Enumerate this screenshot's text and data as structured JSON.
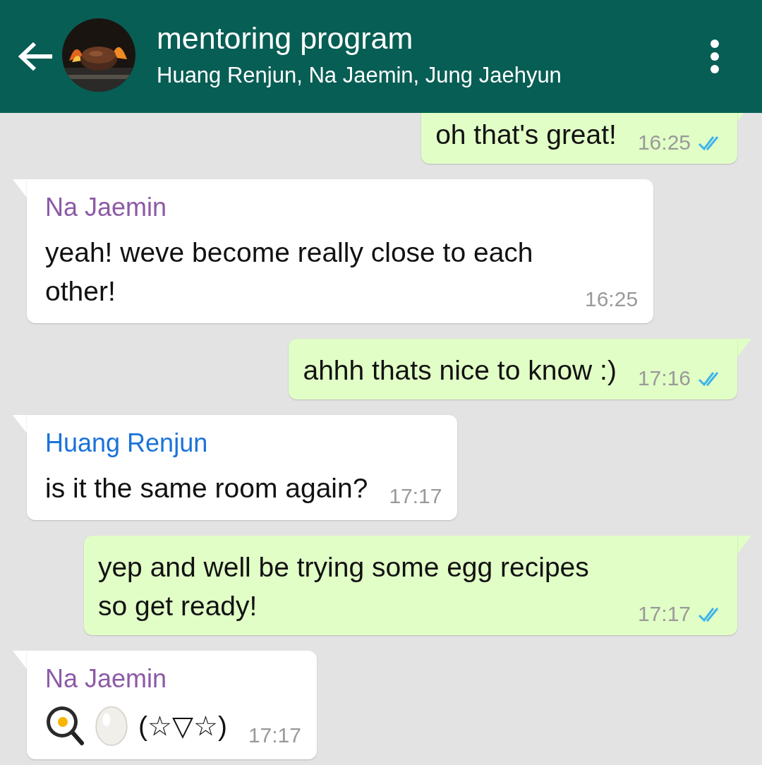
{
  "header": {
    "title": "mentoring program",
    "members": "Huang Renjun, Na Jaemin, Jung Jaehyun"
  },
  "messages": [
    {
      "outgoing": true,
      "kind": "text",
      "text": "oh that's great!",
      "time": "16:25",
      "read": true
    },
    {
      "outgoing": false,
      "kind": "text",
      "sender": "Na Jaemin",
      "color": "#8c5aa6",
      "text": "yeah! weve become really close to each other!",
      "time": "16:25"
    },
    {
      "outgoing": true,
      "kind": "text",
      "text": "ahhh thats nice to know :)",
      "time": "17:16",
      "read": true
    },
    {
      "outgoing": false,
      "kind": "text",
      "sender": "Huang Renjun",
      "color": "#1a73d9",
      "text": "is it the same room again?",
      "time": "17:17"
    },
    {
      "outgoing": true,
      "kind": "text",
      "text": "yep and well be trying some egg recipes so get ready!",
      "time": "17:17",
      "read": true
    },
    {
      "outgoing": false,
      "kind": "emoji_text",
      "sender": "Na Jaemin",
      "color": "#8c5aa6",
      "text": "(☆▽☆)",
      "time": "17:17"
    }
  ]
}
